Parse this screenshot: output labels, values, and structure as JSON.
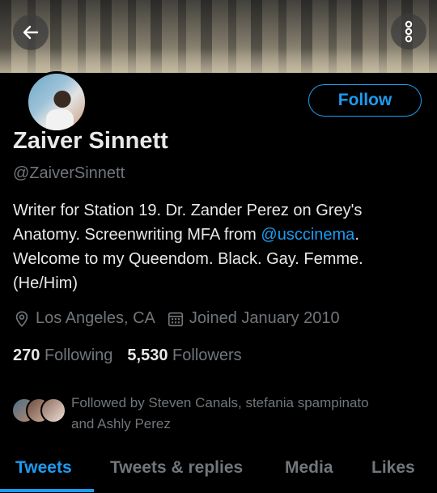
{
  "header": {
    "back_icon": "arrow-left-icon",
    "more_icon": "more-vertical-icon"
  },
  "profile": {
    "follow_label": "Follow",
    "name": "Zaiver Sinnett",
    "handle": "@ZaiverSinnett",
    "bio_line1": "Writer for Station 19. Dr. Zander Perez on Grey's",
    "bio_line2_pre": "Anatomy. Screenwriting MFA from ",
    "bio_mention": "@usccinema",
    "bio_line2_post": ".",
    "bio_line3": "Welcome to my Queendom. Black. Gay. Femme.",
    "bio_line4": "(He/Him)",
    "location": "Los Angeles, CA",
    "joined": "Joined January 2010",
    "following_count": "270",
    "following_label": "Following",
    "followers_count": "5,530",
    "followers_label": "Followers",
    "followed_by_line1": "Followed by Steven Canals, stefania spampinato",
    "followed_by_line2": "and Ashly Perez"
  },
  "tabs": [
    {
      "label": "Tweets",
      "active": true
    },
    {
      "label": "Tweets & replies",
      "active": false
    },
    {
      "label": "Media",
      "active": false
    },
    {
      "label": "Likes",
      "active": false
    }
  ],
  "colors": {
    "accent": "#1d9bf0",
    "background": "#000000",
    "muted_text": "#71767b",
    "text": "#e7e9ea"
  }
}
